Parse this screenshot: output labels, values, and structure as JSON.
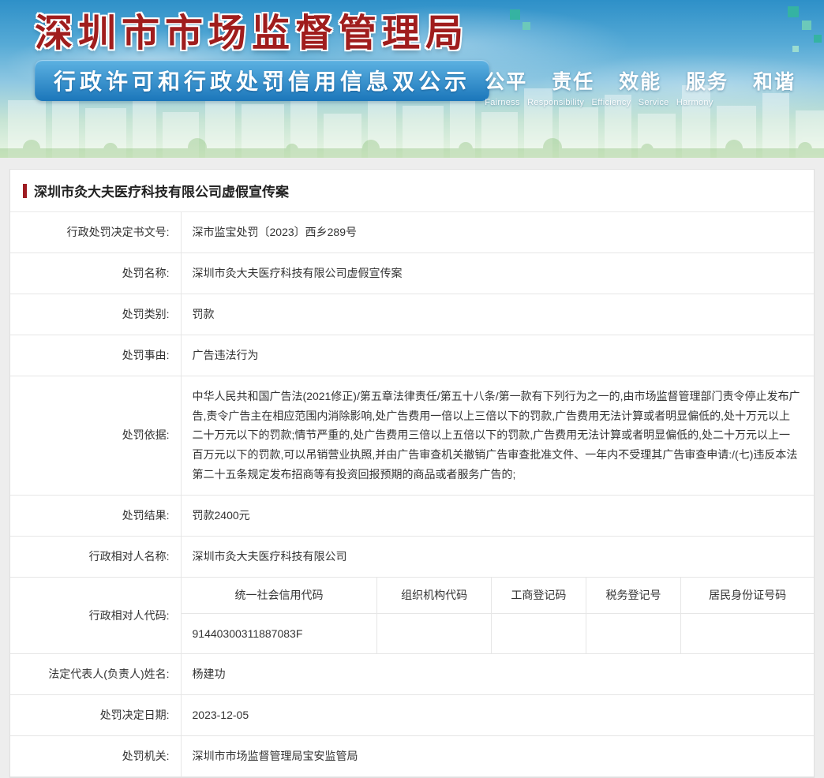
{
  "colors": {
    "accent_red": "#9e1c22",
    "banner_sky_blue": "#2e90c8",
    "ribbon_blue": "#1b76ba",
    "pixel_teal": "#35b3a2"
  },
  "banner": {
    "title": "深圳市市场监督管理局",
    "subtitle": "行政许可和行政处罚信用信息双公示",
    "slogan_cn": "公平 责任 效能 服务 和谐",
    "slogan_en": "Fairness Responsibility Efficiency Service Harmony"
  },
  "case": {
    "title": "深圳市灸大夫医疗科技有限公司虚假宣传案"
  },
  "rows": [
    {
      "label": "行政处罚决定书文号:",
      "value": "深市监宝处罚〔2023〕西乡289号"
    },
    {
      "label": "处罚名称:",
      "value": "深圳市灸大夫医疗科技有限公司虚假宣传案"
    },
    {
      "label": "处罚类别:",
      "value": "罚款"
    },
    {
      "label": "处罚事由:",
      "value": "广告违法行为"
    },
    {
      "label": "处罚依据:",
      "value": "中华人民共和国广告法(2021修正)/第五章法律责任/第五十八条/第一款有下列行为之一的,由市场监督管理部门责令停止发布广告,责令广告主在相应范围内消除影响,处广告费用一倍以上三倍以下的罚款,广告费用无法计算或者明显偏低的,处十万元以上二十万元以下的罚款;情节严重的,处广告费用三倍以上五倍以下的罚款,广告费用无法计算或者明显偏低的,处二十万元以上一百万元以下的罚款,可以吊销营业执照,并由广告审查机关撤销广告审查批准文件、一年内不受理其广告审查申请:/(七)违反本法第二十五条规定发布招商等有投资回报预期的商品或者服务广告的;"
    },
    {
      "label": "处罚结果:",
      "value": "罚款2400元"
    },
    {
      "label": "行政相对人名称:",
      "value": "深圳市灸大夫医疗科技有限公司"
    }
  ],
  "code_section": {
    "label": "行政相对人代码:",
    "columns": [
      "统一社会信用代码",
      "组织机构代码",
      "工商登记码",
      "税务登记号",
      "居民身份证号码"
    ],
    "value": "91440300311887083F"
  },
  "rows2": [
    {
      "label": "法定代表人(负责人)姓名:",
      "value": "杨建功"
    },
    {
      "label": "处罚决定日期:",
      "value": "2023-12-05"
    },
    {
      "label": "处罚机关:",
      "value": "深圳市市场监督管理局宝安监管局"
    }
  ]
}
